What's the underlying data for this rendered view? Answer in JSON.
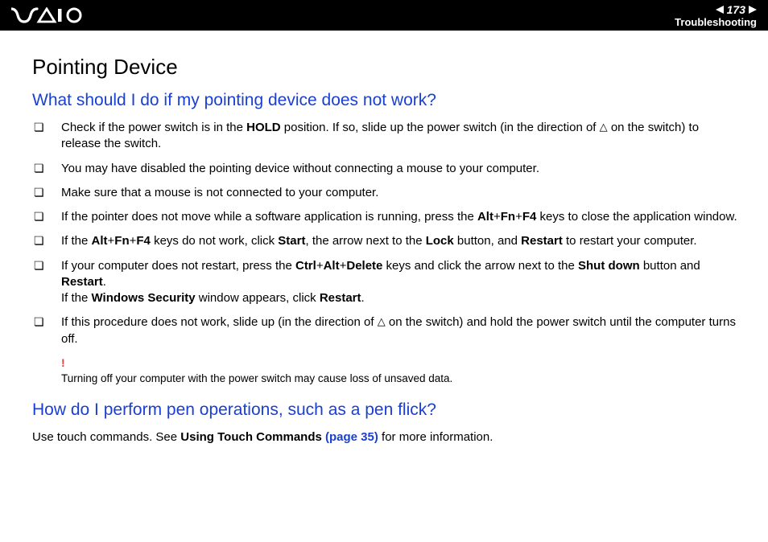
{
  "header": {
    "page_number": "173",
    "section": "Troubleshooting"
  },
  "title": "Pointing Device",
  "q1": {
    "heading": "What should I do if my pointing device does not work?",
    "items": {
      "i0": {
        "pre": "Check if the power switch is in the ",
        "hold": "HOLD",
        "mid": " position. If so, slide up the power switch (in the direction of ",
        "tri": "△",
        "post": " on the switch) to release the switch."
      },
      "i1": "You may have disabled the pointing device without connecting a mouse to your computer.",
      "i2": "Make sure that a mouse is not connected to your computer.",
      "i3": {
        "pre": "If the pointer does not move while a software application is running, press the ",
        "k1": "Alt",
        "p1": "+",
        "k2": "Fn",
        "p2": "+",
        "k3": "F4",
        "post": " keys to close the application window."
      },
      "i4": {
        "pre": "If the ",
        "k1": "Alt",
        "p1": "+",
        "k2": "Fn",
        "p2": "+",
        "k3": "F4",
        "mid1": " keys do not work, click ",
        "b1": "Start",
        "mid2": ", the arrow next to the ",
        "b2": "Lock",
        "mid3": " button, and ",
        "b3": "Restart",
        "post": " to restart your computer."
      },
      "i5": {
        "pre": "If your computer does not restart, press the ",
        "k1": "Ctrl",
        "p1": "+",
        "k2": "Alt",
        "p2": "+",
        "k3": "Delete",
        "mid1": " keys and click the arrow next to the ",
        "b1": "Shut down",
        "mid2": " button and ",
        "b2": "Restart",
        "dot": ".",
        "line2a": "If the ",
        "b3": "Windows Security",
        "line2b": " window appears, click ",
        "b4": "Restart",
        "dot2": "."
      },
      "i6": {
        "pre": "If this procedure does not work, slide up (in the direction of ",
        "tri": "△",
        "post": " on the switch) and hold the power switch until the computer turns off."
      }
    },
    "warning": {
      "mark": "!",
      "text": "Turning off your computer with the power switch may cause loss of unsaved data."
    }
  },
  "q2": {
    "heading": "How do I perform pen operations, such as a pen flick?",
    "para": {
      "pre": "Use touch commands. See ",
      "b1": "Using Touch Commands ",
      "link": "(page 35)",
      "post": " for more information."
    }
  }
}
